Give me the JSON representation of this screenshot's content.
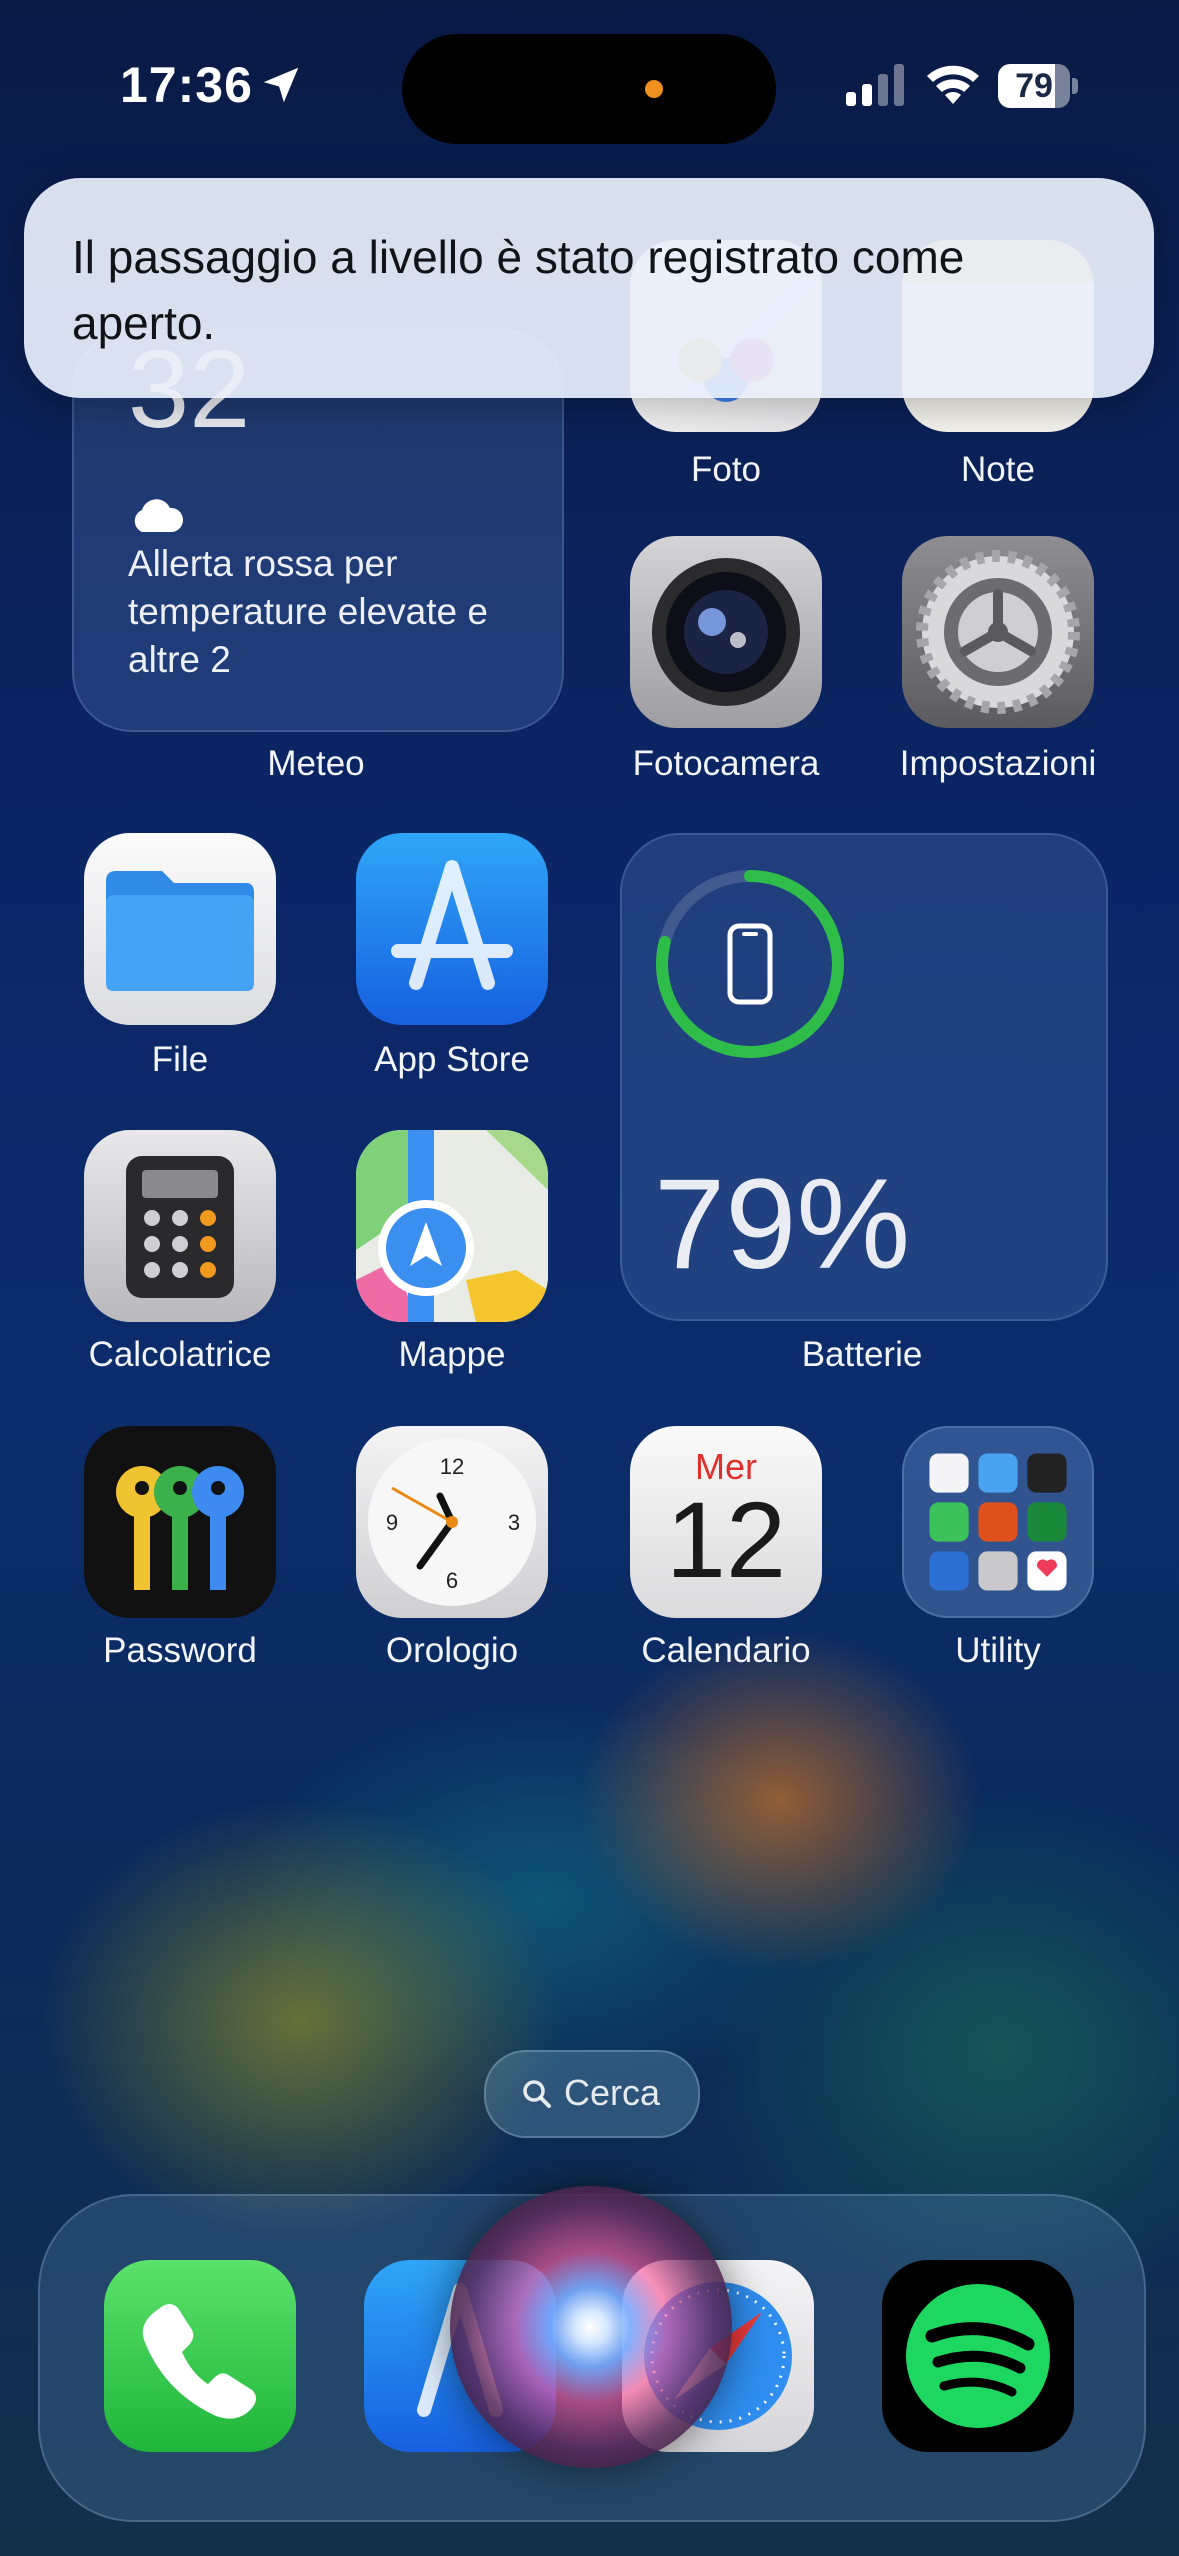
{
  "status_bar": {
    "time": "17:36",
    "battery": "79",
    "battery_level": 0.79
  },
  "banner": {
    "text": "Il passaggio a livello è stato registrato come aperto."
  },
  "weather_widget": {
    "temperature": "32",
    "alert": "Allerta rossa per temperature elevate e altre 2",
    "label": "Meteo"
  },
  "battery_widget": {
    "percent": "79%",
    "label": "Batterie",
    "ring_level": 0.79
  },
  "apps": {
    "foto": "Foto",
    "note": "Note",
    "fotocamera": "Fotocamera",
    "impostazioni": "Impostazioni",
    "file": "File",
    "app_store": "App Store",
    "calcolatrice": "Calcolatrice",
    "mappe": "Mappe",
    "password": "Password",
    "orologio": "Orologio",
    "calendario": "Calendario",
    "utility": "Utility"
  },
  "calendar": {
    "weekday": "Mer",
    "day": "12"
  },
  "clock_numbers": {
    "twelve": "12",
    "three": "3",
    "six": "6",
    "nine": "9"
  },
  "search": {
    "label": "Cerca"
  },
  "dock": [
    "phone-app",
    "testflight-app",
    "safari-app",
    "spotify-app"
  ],
  "colors": {
    "accent_green": "#2fbd4a",
    "calendar_red": "#e0302c"
  }
}
